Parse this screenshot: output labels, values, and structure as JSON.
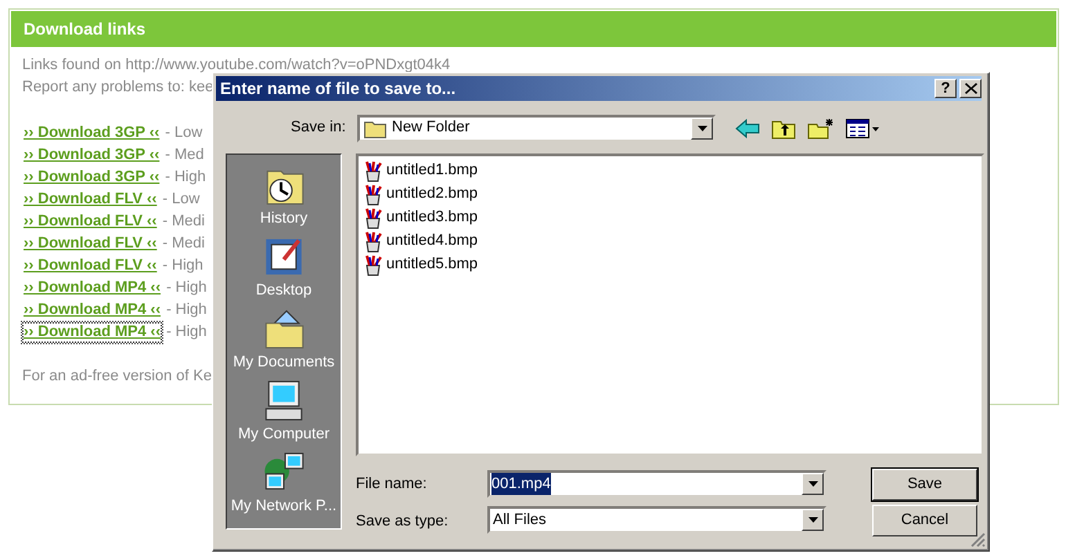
{
  "panel": {
    "title": "Download links",
    "links_found_label": "Links found on",
    "source_url": "http://www.youtube.com/watch?v=oPNDxgt04k4",
    "report_text": "Report any problems to: kee",
    "downloads": [
      {
        "link": "›› Download 3GP ‹‹",
        "quality": "- Low",
        "focused": false
      },
      {
        "link": "›› Download 3GP ‹‹",
        "quality": "- Med",
        "focused": false
      },
      {
        "link": "›› Download 3GP ‹‹",
        "quality": "- High",
        "focused": false
      },
      {
        "link": "›› Download FLV ‹‹",
        "quality": "- Low",
        "focused": false
      },
      {
        "link": "›› Download FLV ‹‹",
        "quality": "- Medi",
        "focused": false
      },
      {
        "link": "›› Download FLV ‹‹",
        "quality": "- Medi",
        "focused": false
      },
      {
        "link": "›› Download FLV ‹‹",
        "quality": "- High",
        "focused": false
      },
      {
        "link": "›› Download MP4 ‹‹",
        "quality": "- High",
        "focused": false
      },
      {
        "link": "›› Download MP4 ‹‹",
        "quality": "- High",
        "focused": false
      },
      {
        "link": "›› Download MP4 ‹‹",
        "quality": "- High",
        "focused": true
      }
    ],
    "footer_text": "For an ad-free version of Ke"
  },
  "dialog": {
    "title": "Enter name of file to save to...",
    "help": "?",
    "save_in_label": "Save in:",
    "save_in_value": "New Folder",
    "places": [
      {
        "label": "History",
        "kind": "history"
      },
      {
        "label": "Desktop",
        "kind": "desktop"
      },
      {
        "label": "My Documents",
        "kind": "documents"
      },
      {
        "label": "My Computer",
        "kind": "computer"
      },
      {
        "label": "My Network P...",
        "kind": "network"
      }
    ],
    "files": [
      "untitled1.bmp",
      "untitled2.bmp",
      "untitled3.bmp",
      "untitled4.bmp",
      "untitled5.bmp"
    ],
    "file_name_label": "File name:",
    "file_name_value": "001.mp4",
    "file_name_highlighted": true,
    "save_as_type_label": "Save as type:",
    "save_as_type_value": "All Files",
    "buttons": [
      {
        "label": "Save",
        "default": true
      },
      {
        "label": "Cancel",
        "default": false
      }
    ]
  }
}
